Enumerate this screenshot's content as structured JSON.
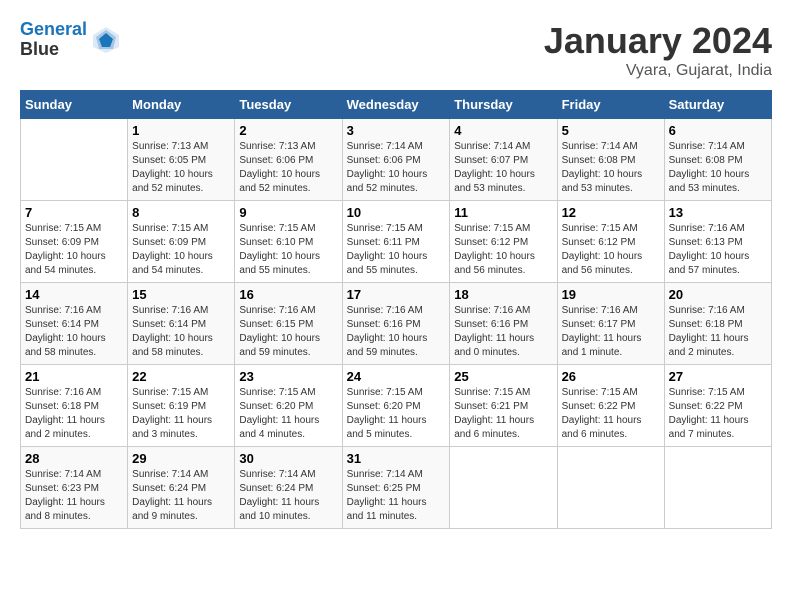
{
  "header": {
    "logo_line1": "General",
    "logo_line2": "Blue",
    "month_title": "January 2024",
    "location": "Vyara, Gujarat, India"
  },
  "days_of_week": [
    "Sunday",
    "Monday",
    "Tuesday",
    "Wednesday",
    "Thursday",
    "Friday",
    "Saturday"
  ],
  "weeks": [
    [
      {
        "day": "",
        "sunrise": "",
        "sunset": "",
        "daylight": ""
      },
      {
        "day": "1",
        "sunrise": "7:13 AM",
        "sunset": "6:05 PM",
        "daylight": "10 hours and 52 minutes."
      },
      {
        "day": "2",
        "sunrise": "7:13 AM",
        "sunset": "6:06 PM",
        "daylight": "10 hours and 52 minutes."
      },
      {
        "day": "3",
        "sunrise": "7:14 AM",
        "sunset": "6:06 PM",
        "daylight": "10 hours and 52 minutes."
      },
      {
        "day": "4",
        "sunrise": "7:14 AM",
        "sunset": "6:07 PM",
        "daylight": "10 hours and 53 minutes."
      },
      {
        "day": "5",
        "sunrise": "7:14 AM",
        "sunset": "6:08 PM",
        "daylight": "10 hours and 53 minutes."
      },
      {
        "day": "6",
        "sunrise": "7:14 AM",
        "sunset": "6:08 PM",
        "daylight": "10 hours and 53 minutes."
      }
    ],
    [
      {
        "day": "7",
        "sunrise": "7:15 AM",
        "sunset": "6:09 PM",
        "daylight": "10 hours and 54 minutes."
      },
      {
        "day": "8",
        "sunrise": "7:15 AM",
        "sunset": "6:09 PM",
        "daylight": "10 hours and 54 minutes."
      },
      {
        "day": "9",
        "sunrise": "7:15 AM",
        "sunset": "6:10 PM",
        "daylight": "10 hours and 55 minutes."
      },
      {
        "day": "10",
        "sunrise": "7:15 AM",
        "sunset": "6:11 PM",
        "daylight": "10 hours and 55 minutes."
      },
      {
        "day": "11",
        "sunrise": "7:15 AM",
        "sunset": "6:12 PM",
        "daylight": "10 hours and 56 minutes."
      },
      {
        "day": "12",
        "sunrise": "7:15 AM",
        "sunset": "6:12 PM",
        "daylight": "10 hours and 56 minutes."
      },
      {
        "day": "13",
        "sunrise": "7:16 AM",
        "sunset": "6:13 PM",
        "daylight": "10 hours and 57 minutes."
      }
    ],
    [
      {
        "day": "14",
        "sunrise": "7:16 AM",
        "sunset": "6:14 PM",
        "daylight": "10 hours and 58 minutes."
      },
      {
        "day": "15",
        "sunrise": "7:16 AM",
        "sunset": "6:14 PM",
        "daylight": "10 hours and 58 minutes."
      },
      {
        "day": "16",
        "sunrise": "7:16 AM",
        "sunset": "6:15 PM",
        "daylight": "10 hours and 59 minutes."
      },
      {
        "day": "17",
        "sunrise": "7:16 AM",
        "sunset": "6:16 PM",
        "daylight": "10 hours and 59 minutes."
      },
      {
        "day": "18",
        "sunrise": "7:16 AM",
        "sunset": "6:16 PM",
        "daylight": "11 hours and 0 minutes."
      },
      {
        "day": "19",
        "sunrise": "7:16 AM",
        "sunset": "6:17 PM",
        "daylight": "11 hours and 1 minute."
      },
      {
        "day": "20",
        "sunrise": "7:16 AM",
        "sunset": "6:18 PM",
        "daylight": "11 hours and 2 minutes."
      }
    ],
    [
      {
        "day": "21",
        "sunrise": "7:16 AM",
        "sunset": "6:18 PM",
        "daylight": "11 hours and 2 minutes."
      },
      {
        "day": "22",
        "sunrise": "7:15 AM",
        "sunset": "6:19 PM",
        "daylight": "11 hours and 3 minutes."
      },
      {
        "day": "23",
        "sunrise": "7:15 AM",
        "sunset": "6:20 PM",
        "daylight": "11 hours and 4 minutes."
      },
      {
        "day": "24",
        "sunrise": "7:15 AM",
        "sunset": "6:20 PM",
        "daylight": "11 hours and 5 minutes."
      },
      {
        "day": "25",
        "sunrise": "7:15 AM",
        "sunset": "6:21 PM",
        "daylight": "11 hours and 6 minutes."
      },
      {
        "day": "26",
        "sunrise": "7:15 AM",
        "sunset": "6:22 PM",
        "daylight": "11 hours and 6 minutes."
      },
      {
        "day": "27",
        "sunrise": "7:15 AM",
        "sunset": "6:22 PM",
        "daylight": "11 hours and 7 minutes."
      }
    ],
    [
      {
        "day": "28",
        "sunrise": "7:14 AM",
        "sunset": "6:23 PM",
        "daylight": "11 hours and 8 minutes."
      },
      {
        "day": "29",
        "sunrise": "7:14 AM",
        "sunset": "6:24 PM",
        "daylight": "11 hours and 9 minutes."
      },
      {
        "day": "30",
        "sunrise": "7:14 AM",
        "sunset": "6:24 PM",
        "daylight": "11 hours and 10 minutes."
      },
      {
        "day": "31",
        "sunrise": "7:14 AM",
        "sunset": "6:25 PM",
        "daylight": "11 hours and 11 minutes."
      },
      {
        "day": "",
        "sunrise": "",
        "sunset": "",
        "daylight": ""
      },
      {
        "day": "",
        "sunrise": "",
        "sunset": "",
        "daylight": ""
      },
      {
        "day": "",
        "sunrise": "",
        "sunset": "",
        "daylight": ""
      }
    ]
  ]
}
